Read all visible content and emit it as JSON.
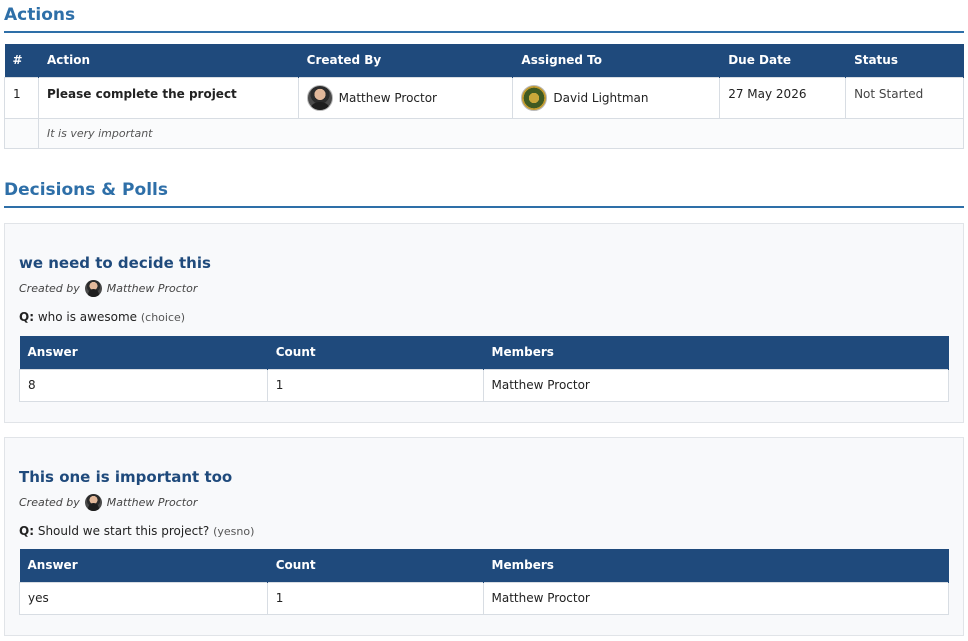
{
  "actions": {
    "title": "Actions",
    "headers": [
      "#",
      "Action",
      "Created By",
      "Assigned To",
      "Due Date",
      "Status"
    ],
    "rows": [
      {
        "num": "1",
        "action": "Please complete the project",
        "created_by": "Matthew Proctor",
        "assigned_to": "David Lightman",
        "due_date": "27 May 2026",
        "status": "Not Started",
        "note": "It is very important"
      }
    ]
  },
  "polls": {
    "title": "Decisions & Polls",
    "items": [
      {
        "title": "we need to decide this",
        "created_prefix": "Created by",
        "created_by": "Matthew Proctor",
        "q_label": "Q:",
        "question": "who is awesome",
        "type": "(choice)",
        "headers": [
          "Answer",
          "Count",
          "Members"
        ],
        "rows": [
          {
            "answer": "8",
            "count": "1",
            "members": "Matthew Proctor"
          }
        ]
      },
      {
        "title": "This one is important too",
        "created_prefix": "Created by",
        "created_by": "Matthew Proctor",
        "q_label": "Q:",
        "question": "Should we start this project?",
        "type": "(yesno)",
        "headers": [
          "Answer",
          "Count",
          "Members"
        ],
        "rows": [
          {
            "answer": "yes",
            "count": "1",
            "members": "Matthew Proctor"
          }
        ]
      }
    ]
  },
  "icons": {
    "creator_avatar": "person-avatar-icon",
    "assignee_avatar": "seal-avatar-icon"
  },
  "colors": {
    "accent": "#2e6fa8",
    "header_bg": "#1f4a7c"
  }
}
